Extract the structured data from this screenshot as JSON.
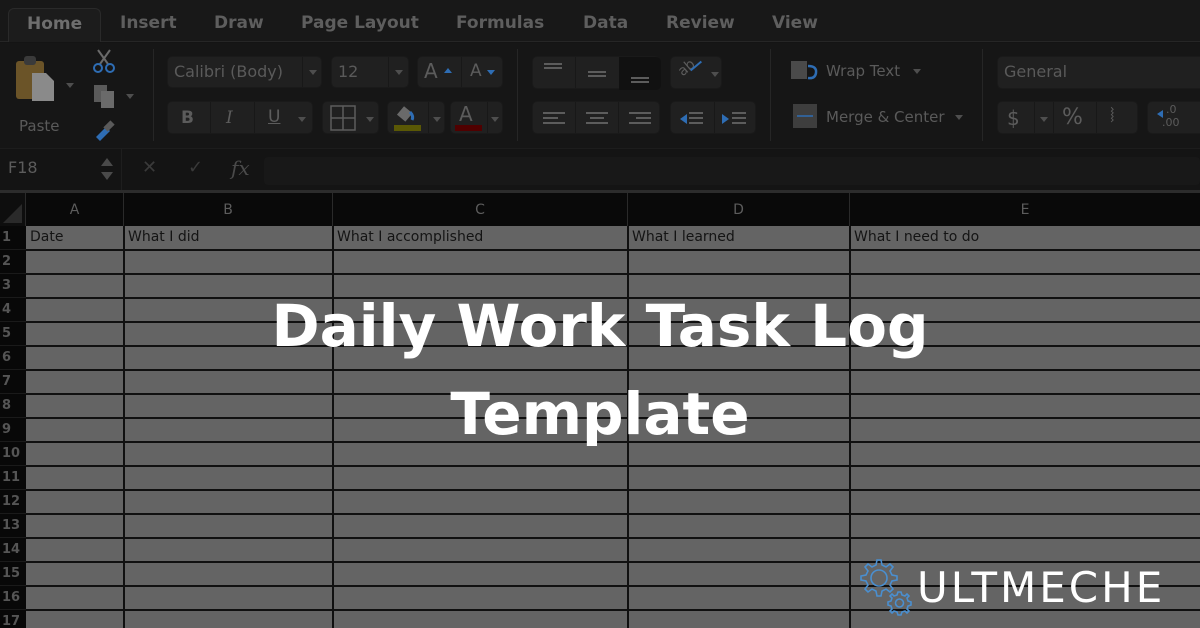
{
  "tabs": [
    {
      "label": "Home",
      "active": true
    },
    {
      "label": "Insert"
    },
    {
      "label": "Draw"
    },
    {
      "label": "Page Layout"
    },
    {
      "label": "Formulas"
    },
    {
      "label": "Data"
    },
    {
      "label": "Review"
    },
    {
      "label": "View"
    }
  ],
  "ribbon": {
    "paste_label": "Paste",
    "font_name": "Calibri (Body)",
    "font_size": "12",
    "bold": "B",
    "italic": "I",
    "underline": "U",
    "grow_font": "A",
    "shrink_font": "A",
    "font_color_glyph": "A",
    "wrap_text": "Wrap Text",
    "merge_center": "Merge & Center",
    "number_format": "General",
    "currency": "$",
    "percent": "%",
    "comma": ",",
    "decimal_increase_top": ".0",
    "decimal_increase_bottom": ".00",
    "fill_color": "#b5b30a",
    "font_color": "#a00000",
    "accent": "#2e6db4"
  },
  "formula_bar": {
    "name_box": "F18",
    "fx_label": "fx",
    "cancel": "✕",
    "confirm": "✓",
    "value": ""
  },
  "sheet": {
    "columns": [
      "A",
      "B",
      "C",
      "D",
      "E"
    ],
    "header_row": [
      "Date",
      "What I did",
      "What I accomplished",
      "What I learned",
      "What I need to do"
    ],
    "row_numbers": [
      "1",
      "2",
      "3",
      "4",
      "5",
      "6",
      "7",
      "8",
      "9",
      "10",
      "11",
      "12",
      "13",
      "14",
      "15",
      "16",
      "17"
    ]
  },
  "overlay": {
    "title_line1": "Daily Work Task Log",
    "title_line2": "Template"
  },
  "brand": {
    "name": "ULTMECHE",
    "icon": "gears-icon",
    "icon_color": "#4a8fd0"
  }
}
